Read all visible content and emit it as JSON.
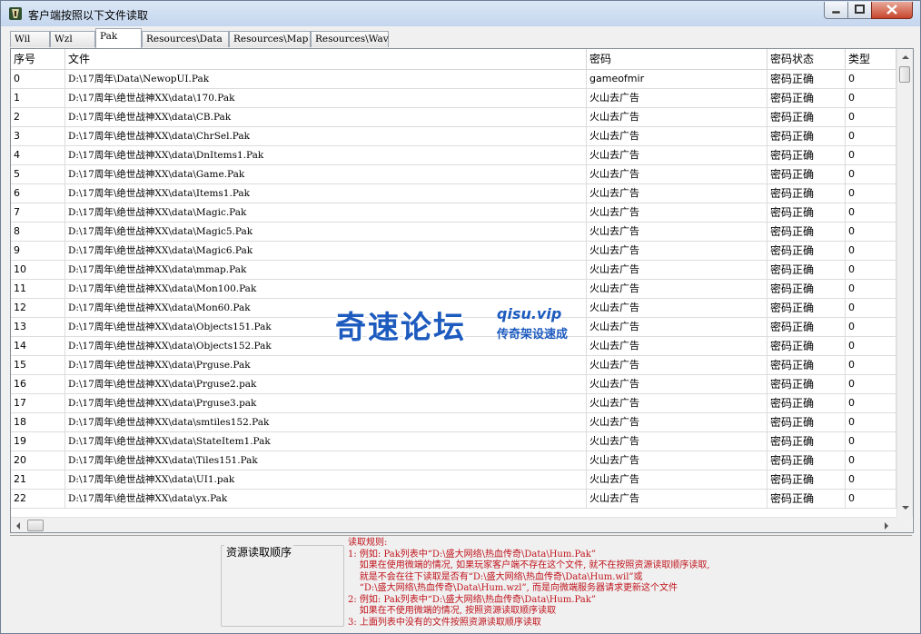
{
  "window": {
    "title": "客户端按照以下文件读取"
  },
  "tabs": [
    {
      "label": "Wil",
      "active": false
    },
    {
      "label": "Wzl",
      "active": false
    },
    {
      "label": "Pak",
      "active": true
    },
    {
      "label": "Resources\\Data",
      "active": false
    },
    {
      "label": "Resources\\Map",
      "active": false
    },
    {
      "label": "Resources\\Wav",
      "active": false
    }
  ],
  "table": {
    "columns": [
      "序号",
      "文件",
      "密码",
      "密码状态",
      "类型"
    ],
    "rows": [
      [
        "0",
        "D:\\17周年\\Data\\NewopUI.Pak",
        "gameofmir",
        "密码正确",
        "0"
      ],
      [
        "1",
        "D:\\17周年\\绝世战神XX\\data\\170.Pak",
        "火山去广告",
        "密码正确",
        "0"
      ],
      [
        "2",
        "D:\\17周年\\绝世战神XX\\data\\CB.Pak",
        "火山去广告",
        "密码正确",
        "0"
      ],
      [
        "3",
        "D:\\17周年\\绝世战神XX\\data\\ChrSel.Pak",
        "火山去广告",
        "密码正确",
        "0"
      ],
      [
        "4",
        "D:\\17周年\\绝世战神XX\\data\\DnItems1.Pak",
        "火山去广告",
        "密码正确",
        "0"
      ],
      [
        "5",
        "D:\\17周年\\绝世战神XX\\data\\Game.Pak",
        "火山去广告",
        "密码正确",
        "0"
      ],
      [
        "6",
        "D:\\17周年\\绝世战神XX\\data\\Items1.Pak",
        "火山去广告",
        "密码正确",
        "0"
      ],
      [
        "7",
        "D:\\17周年\\绝世战神XX\\data\\Magic.Pak",
        "火山去广告",
        "密码正确",
        "0"
      ],
      [
        "8",
        "D:\\17周年\\绝世战神XX\\data\\Magic5.Pak",
        "火山去广告",
        "密码正确",
        "0"
      ],
      [
        "9",
        "D:\\17周年\\绝世战神XX\\data\\Magic6.Pak",
        "火山去广告",
        "密码正确",
        "0"
      ],
      [
        "10",
        "D:\\17周年\\绝世战神XX\\data\\mmap.Pak",
        "火山去广告",
        "密码正确",
        "0"
      ],
      [
        "11",
        "D:\\17周年\\绝世战神XX\\data\\Mon100.Pak",
        "火山去广告",
        "密码正确",
        "0"
      ],
      [
        "12",
        "D:\\17周年\\绝世战神XX\\data\\Mon60.Pak",
        "火山去广告",
        "密码正确",
        "0"
      ],
      [
        "13",
        "D:\\17周年\\绝世战神XX\\data\\Objects151.Pak",
        "火山去广告",
        "密码正确",
        "0"
      ],
      [
        "14",
        "D:\\17周年\\绝世战神XX\\data\\Objects152.Pak",
        "火山去广告",
        "密码正确",
        "0"
      ],
      [
        "15",
        "D:\\17周年\\绝世战神XX\\data\\Prguse.Pak",
        "火山去广告",
        "密码正确",
        "0"
      ],
      [
        "16",
        "D:\\17周年\\绝世战神XX\\data\\Prguse2.pak",
        "火山去广告",
        "密码正确",
        "0"
      ],
      [
        "17",
        "D:\\17周年\\绝世战神XX\\data\\Prguse3.pak",
        "火山去广告",
        "密码正确",
        "0"
      ],
      [
        "18",
        "D:\\17周年\\绝世战神XX\\data\\smtiles152.Pak",
        "火山去广告",
        "密码正确",
        "0"
      ],
      [
        "19",
        "D:\\17周年\\绝世战神XX\\data\\StateItem1.Pak",
        "火山去广告",
        "密码正确",
        "0"
      ],
      [
        "20",
        "D:\\17周年\\绝世战神XX\\data\\Tiles151.Pak",
        "火山去广告",
        "密码正确",
        "0"
      ],
      [
        "21",
        "D:\\17周年\\绝世战神XX\\data\\UI1.pak",
        "火山去广告",
        "密码正确",
        "0"
      ],
      [
        "22",
        "D:\\17周年\\绝世战神XX\\data\\yx.Pak",
        "火山去广告",
        "密码正确",
        "0"
      ]
    ]
  },
  "resource_order": {
    "title": "资源读取顺序"
  },
  "rules": {
    "lines": [
      "读取规则:",
      "1: 例如: Pak列表中“D:\\盛大网络\\热血传奇\\Data\\Hum.Pak”",
      "    如果在使用微端的情况, 如果玩家客户端不存在这个文件, 就不在按照资源读取顺序读取,",
      "    就是不会在往下读取是否有“D:\\盛大网络\\热血传奇\\Data\\Hum.wil”或",
      "    “D:\\盛大网络\\热血传奇\\Data\\Hum.wzl”, 而是向微端服务器请求更新这个文件",
      "2: 例如: Pak列表中“D:\\盛大网络\\热血传奇\\Data\\Hum.Pak”",
      "    如果在不使用微端的情况, 按照资源读取顺序读取",
      "3: 上面列表中没有的文件按照资源读取顺序读取"
    ]
  },
  "watermark": {
    "main": "奇速论坛",
    "url": "qisu.vip",
    "sub": "传奇架设速成"
  },
  "colors": {
    "rules_text": "#c0141c",
    "watermark": "#1d5bbf",
    "title_bar": "#c4d6ee"
  }
}
